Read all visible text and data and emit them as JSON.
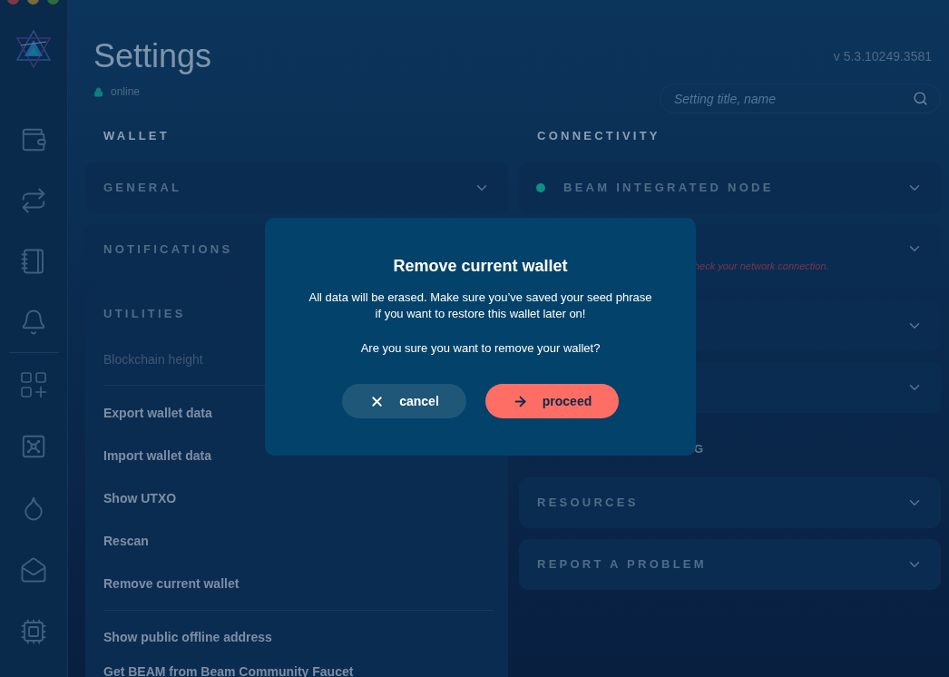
{
  "header": {
    "title": "Settings",
    "status": "online",
    "version": "v 5.3.10249.3581",
    "search": {
      "placeholder": "Setting title, name"
    }
  },
  "wallet": {
    "heading": "WALLET",
    "panels": [
      {
        "title": "GENERAL",
        "expanded": false
      },
      {
        "title": "NOTIFICATIONS"
      }
    ],
    "utilities": {
      "title": "UTILITIES",
      "blockchain_height_label": "Blockchain height",
      "items": [
        "Export wallet data",
        "Import wallet data",
        "Show UTXO",
        "Rescan",
        "Remove current wallet"
      ],
      "items_2": [
        "Show public offline address",
        "Get BEAM from Beam Community Faucet"
      ]
    }
  },
  "connectivity": {
    "heading": "CONNECTIVITY",
    "panels": [
      {
        "kind": "node",
        "title": "BEAM INTEGRATED NODE",
        "expanded": false
      },
      {
        "kind": "error",
        "error": "heck your network connection.",
        "expanded": false
      },
      {
        "kind": "plain",
        "expanded": false
      },
      {
        "kind": "plain",
        "expanded": false
      }
    ],
    "section_fragment": "G",
    "panels_2": [
      {
        "title": "RESOURCES",
        "expanded": false
      },
      {
        "title": "REPORT A PROBLEM",
        "expanded": false
      }
    ]
  },
  "dialog": {
    "title": "Remove current wallet",
    "message_lines": [
      "All data will be erased. Make sure you’ve saved your seed phrase",
      "if you want to restore this wallet later on!"
    ],
    "question": "Are you sure you want to remove your wallet?",
    "buttons": [
      {
        "kind": "cancel",
        "label": "cancel"
      },
      {
        "kind": "proceed",
        "label": "proceed"
      }
    ]
  }
}
